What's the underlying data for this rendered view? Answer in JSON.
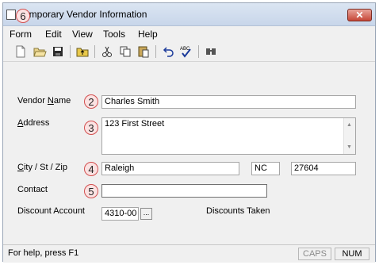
{
  "window": {
    "title": "Temporary Vendor Information",
    "close_label": "✕"
  },
  "menu": {
    "items": [
      "Form",
      "Edit",
      "View",
      "Tools",
      "Help"
    ]
  },
  "toolbar": {
    "icons": [
      "new-file-icon",
      "open-folder-icon",
      "save-icon",
      "up-folder-icon",
      "cut-icon",
      "copy-icon",
      "paste-icon",
      "undo-icon",
      "spell-check-icon",
      "find-icon"
    ]
  },
  "form": {
    "vendor_name": {
      "label_pre": "Vendor ",
      "label_ul": "N",
      "label_post": "ame",
      "value": "Charles Smith"
    },
    "address": {
      "label_pre": "",
      "label_ul": "A",
      "label_post": "ddress",
      "value": "123 First Street"
    },
    "city": {
      "label_pre": "",
      "label_ul": "C",
      "label_post": "ity / St / Zip",
      "city_value": "Raleigh",
      "state_value": "NC",
      "zip_value": "27604"
    },
    "contact": {
      "label": "Contact",
      "value": ""
    },
    "discount_account": {
      "label": "Discount Account",
      "value": "4310-00",
      "browse_label": "..."
    },
    "discounts_taken_label": "Discounts Taken"
  },
  "annotations": {
    "badges": [
      "2",
      "3",
      "4",
      "5",
      "6"
    ]
  },
  "status": {
    "help_text": "For help, press F1",
    "caps": "CAPS",
    "num": "NUM"
  },
  "colors": {
    "badge_border": "#d35050",
    "badge_fill": "#fbe2e2",
    "close_button": "#c64636"
  }
}
